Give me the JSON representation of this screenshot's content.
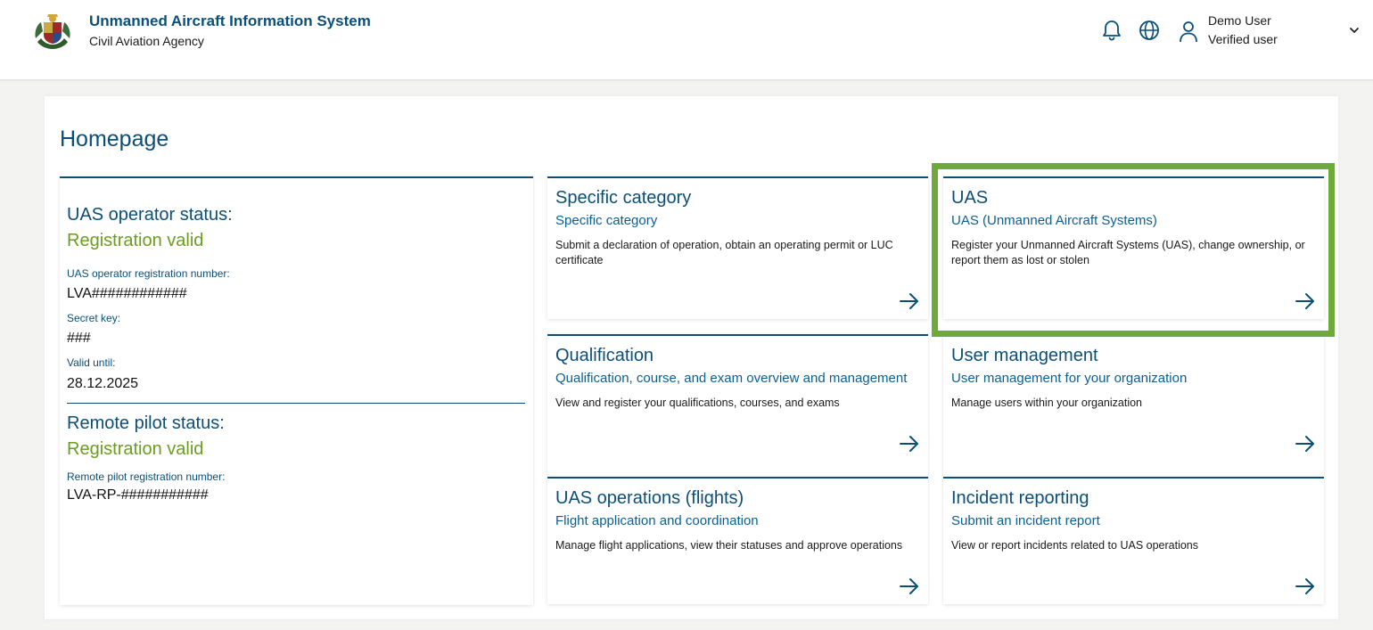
{
  "header": {
    "app_title": "Unmanned Aircraft Information System",
    "app_subtitle": "Civil Aviation Agency",
    "logo_icon": "coat-of-arms-icon",
    "user_name": "Demo User",
    "user_role": "Verified user"
  },
  "page": {
    "title": "Homepage"
  },
  "status": {
    "operator_heading": "UAS operator status:",
    "operator_state": "Registration valid",
    "reg_number_label": "UAS operator registration number:",
    "reg_number_value": "LVA############",
    "secret_key_label": "Secret key:",
    "secret_key_value": "###",
    "valid_until_label": "Valid until:",
    "valid_until_value": "28.12.2025",
    "pilot_heading": "Remote pilot status:",
    "pilot_state": "Registration valid",
    "pilot_reg_label": "Remote pilot registration number:",
    "pilot_reg_value": "LVA-RP-###########"
  },
  "tiles": [
    {
      "title": "Specific category",
      "subtitle": "Specific category",
      "description": "Submit a declaration of operation, obtain an operating permit or LUC certificate"
    },
    {
      "title": "UAS",
      "subtitle": "UAS (Unmanned Aircraft Systems)",
      "description": "Register your Unmanned Aircraft Systems (UAS), change ownership, or report them as lost or stolen"
    },
    {
      "title": "Qualification",
      "subtitle": "Qualification, course, and exam overview and management",
      "description": "View and register your qualifications, courses, and exams"
    },
    {
      "title": "User management",
      "subtitle": "User management for your organization",
      "description": "Manage users within your organization"
    },
    {
      "title": "UAS operations (flights)",
      "subtitle": "Flight application and coordination",
      "description": "Manage flight applications, view their statuses and approve operations"
    },
    {
      "title": "Incident reporting",
      "subtitle": "Submit an incident report",
      "description": "View or report incidents related to UAS operations"
    }
  ],
  "colors": {
    "primary": "#0b4f79",
    "valid_green": "#6b9d1f",
    "highlight_green": "#6fa83b"
  }
}
